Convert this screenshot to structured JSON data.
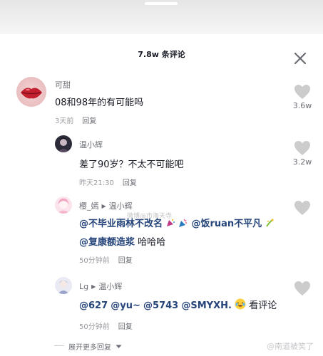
{
  "panel": {
    "title": "7.8w 条评论"
  },
  "comments": [
    {
      "username": "可甜",
      "text": "08和98年的有可能吗",
      "time": "3天前",
      "reply_label": "回复",
      "likes": "3.6w"
    },
    {
      "username": "温小辉",
      "text": "差了90岁？不太不可能吧",
      "time": "昨天21:30",
      "reply_label": "回复",
      "likes": "3.2w"
    },
    {
      "username": "樱_嫣",
      "reply_to": "温小辉",
      "text_parts": [
        "@不毕业雨林不改名",
        "@饭ruan不平凡",
        "@复康额造浆",
        "哈哈哈"
      ],
      "time": "50分钟前",
      "reply_label": "回复"
    },
    {
      "username": "Lg",
      "reply_to": "温小辉",
      "text_parts": [
        "@627",
        "@yu~",
        "@5743",
        "@SMYXH.",
        "看评论"
      ],
      "time": "50分钟前",
      "reply_label": "回复"
    }
  ],
  "expand": {
    "label": "展开更多回复"
  },
  "watermarks": {
    "middle": "微博@市海天寺",
    "bottom": "@南道被笑了"
  },
  "icons": {
    "close": "close-icon",
    "like": "heart-icon",
    "expand": "chevron-down-icon"
  },
  "colors": {
    "mention": "#25447a",
    "heart": "#cccccc",
    "meta": "#9a9ba0"
  }
}
